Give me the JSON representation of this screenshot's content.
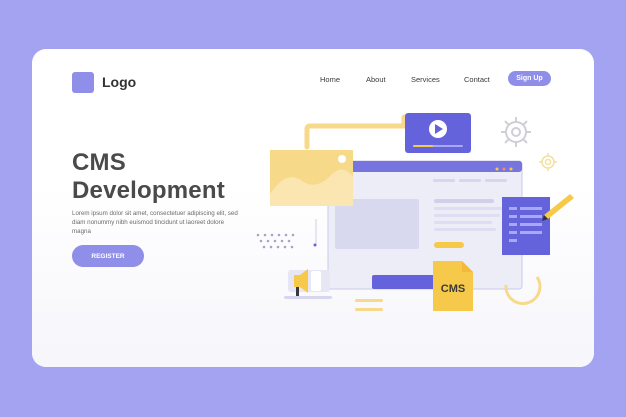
{
  "header": {
    "logo_text": "Logo",
    "nav": [
      "Home",
      "About",
      "Services",
      "Contact"
    ],
    "signup_label": "Sign Up"
  },
  "hero": {
    "title_line1": "CMS",
    "title_line2": "Development",
    "description": "Lorem ipsum dolor sit amet, consectetuer adipiscing elit, sed diam nonummy nibh euismod tincidunt ut laoreet dolore magna",
    "register_label": "REGISTER"
  },
  "illustration": {
    "cms_file_label": "CMS"
  },
  "colors": {
    "background": "#a3a3f2",
    "accent_purple": "#8f8ee8",
    "accent_dark_purple": "#6463dc",
    "accent_yellow": "#f7c94b"
  }
}
